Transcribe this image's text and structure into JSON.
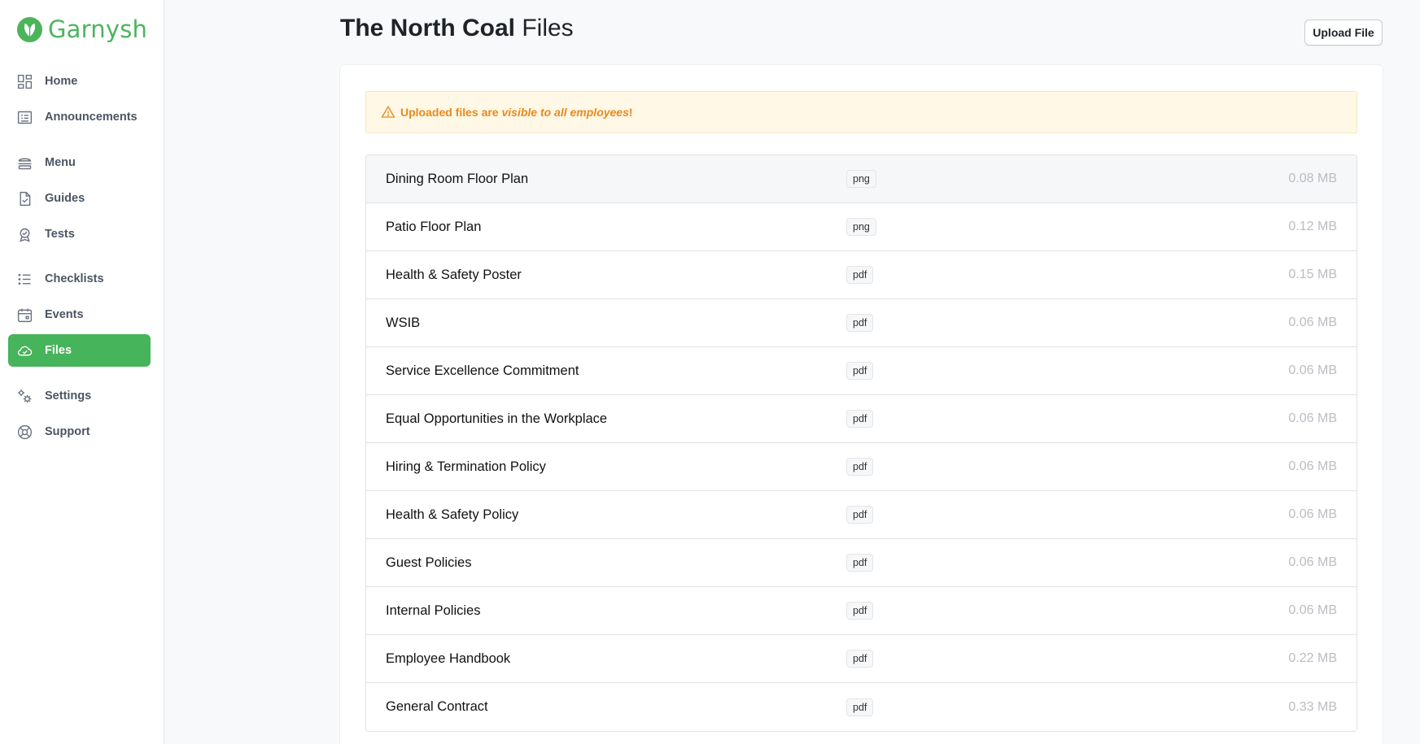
{
  "brand": {
    "name": "Garnysh",
    "color": "#4cb55c"
  },
  "sidebar": {
    "items": [
      {
        "label": "Home",
        "icon": "grid-icon"
      },
      {
        "label": "Announcements",
        "icon": "newspaper-icon"
      },
      {
        "label": "Menu",
        "icon": "burger-icon"
      },
      {
        "label": "Guides",
        "icon": "document-check-icon"
      },
      {
        "label": "Tests",
        "icon": "badge-icon"
      },
      {
        "label": "Checklists",
        "icon": "list-icon"
      },
      {
        "label": "Events",
        "icon": "calendar-icon"
      },
      {
        "label": "Files",
        "icon": "cloud-icon",
        "active": true
      },
      {
        "label": "Settings",
        "icon": "gears-icon"
      },
      {
        "label": "Support",
        "icon": "lifebuoy-icon"
      }
    ],
    "active_color": "#46b45a"
  },
  "header": {
    "title_bold": "The North Coal",
    "title_light": "Files",
    "upload_label": "Upload File"
  },
  "alert": {
    "prefix": "Uploaded files are ",
    "emphasis": "visible to all employees",
    "suffix": "!",
    "icon": "warning-icon",
    "color": "#e8891c"
  },
  "files": [
    {
      "name": "Dining Room Floor Plan",
      "type": "png",
      "size": "0.08 MB"
    },
    {
      "name": "Patio Floor Plan",
      "type": "png",
      "size": "0.12 MB"
    },
    {
      "name": "Health & Safety Poster",
      "type": "pdf",
      "size": "0.15 MB"
    },
    {
      "name": "WSIB",
      "type": "pdf",
      "size": "0.06 MB"
    },
    {
      "name": "Service Excellence Commitment",
      "type": "pdf",
      "size": "0.06 MB"
    },
    {
      "name": "Equal Opportunities in the Workplace",
      "type": "pdf",
      "size": "0.06 MB"
    },
    {
      "name": "Hiring & Termination Policy",
      "type": "pdf",
      "size": "0.06 MB"
    },
    {
      "name": "Health & Safety Policy",
      "type": "pdf",
      "size": "0.06 MB"
    },
    {
      "name": "Guest Policies",
      "type": "pdf",
      "size": "0.06 MB"
    },
    {
      "name": "Internal Policies",
      "type": "pdf",
      "size": "0.06 MB"
    },
    {
      "name": "Employee Handbook",
      "type": "pdf",
      "size": "0.22 MB"
    },
    {
      "name": "General Contract",
      "type": "pdf",
      "size": "0.33 MB"
    }
  ]
}
